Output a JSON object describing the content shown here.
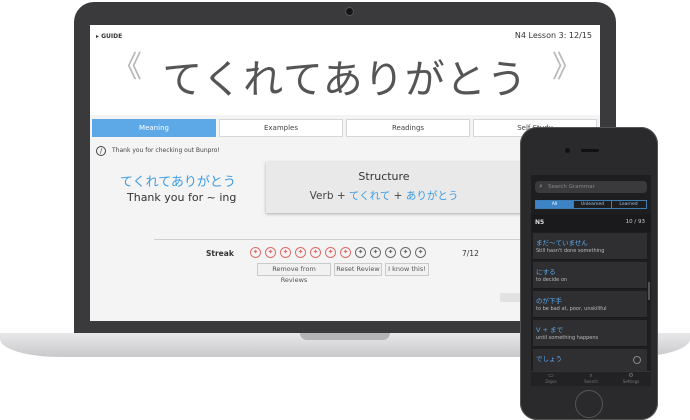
{
  "laptop": {
    "guide_label": "▸ GUIDE",
    "lesson_progress": "N4 Lesson 3: 12/15",
    "grammar_point": "てくれてありがとう",
    "tabs": [
      "Meaning",
      "Examples",
      "Readings",
      "Self Study"
    ],
    "active_tab": "Meaning",
    "notice": "Thank you for checking out Bunpro!",
    "term": "てくれてありがとう",
    "term_meaning": "Thank you for ~ ing",
    "structure": {
      "title": "Structure",
      "part1": "Verb + ",
      "part2": "てくれて",
      "part3": " + ",
      "part4": "ありがとう"
    },
    "streak_label": "Streak",
    "streak_count": "7/12",
    "buttons": {
      "remove": "Remove from Reviews",
      "reset": "Reset Review",
      "know": "I know this!"
    }
  },
  "phone": {
    "search_placeholder": "Search Grammar",
    "segments": [
      "All",
      "Unlearned",
      "Learned"
    ],
    "section_label": "N5",
    "section_count": "10 / 93",
    "items": [
      {
        "term": "まだ〜ていません",
        "meaning": "Still hasn't done something"
      },
      {
        "term": "にする",
        "meaning": "to decide on"
      },
      {
        "term": "のが下手",
        "meaning": "to be bad at, poor, unskillful"
      },
      {
        "term": "V + まで",
        "meaning": "until something happens"
      },
      {
        "term": "でしょう",
        "meaning": ""
      }
    ],
    "tabbar": [
      "Dojos",
      "Search",
      "Settings"
    ]
  },
  "colors": {
    "accent_blue": "#5da9e8",
    "term_blue": "#3d9be2",
    "streak_red": "#e06a6a",
    "streak_grey": "#6a6a6a"
  },
  "icons": {
    "prev": "chevron-left-icon",
    "next": "chevron-right-icon",
    "notice": "pencil-icon",
    "search": "search-icon"
  }
}
